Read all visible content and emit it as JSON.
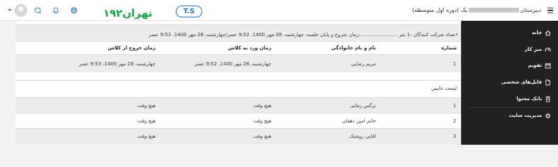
{
  "header": {
    "course_title_start": "دبیرستان",
    "course_title_end": "یک (دوره اول متوسطه)",
    "logo_text": "تهران۱۹۲",
    "logo_badge": "T.S"
  },
  "sidebar": {
    "items": [
      {
        "label": "خانه",
        "icon": "home-icon"
      },
      {
        "label": "میز کار",
        "icon": "dashboard-icon"
      },
      {
        "label": "تقویم",
        "icon": "calendar-icon"
      },
      {
        "label": "فایل‌های شخصی",
        "icon": "file-icon"
      },
      {
        "label": "بانک محتوا",
        "icon": "content-bank-icon"
      },
      {
        "label": "مدیریت سایت",
        "icon": "gear-icon"
      }
    ]
  },
  "session": {
    "info": "•تعداد شرکت کنندگان :1 نفر .........................زمان شروع و پایان جلسه: چهارشنبه، 28 مهر 1400، 9:52 عصر/چهارشنبه، 28 مهر 1400، 9:53 عصر"
  },
  "attendees": {
    "headers": [
      "شماره",
      "نام و نام خانوادگی",
      "زمان ورد به کلاس",
      "زمان خروج از کلاس"
    ],
    "rows": [
      [
        "1",
        "مریم رضایی",
        "چهارشنبه، 28 مهر 1400، 9:52 عصر",
        "چهارشنبه، 28 مهر 1400، 9:53 عصر"
      ]
    ]
  },
  "absentees": {
    "title": "لیست غایبین",
    "rows": [
      [
        "1",
        "نرگس زمانی",
        "هیچ وقت",
        "هیچ وقت"
      ],
      [
        "2",
        "خانم امین دهقان",
        "هیچ وقت",
        "هیچ وقت"
      ],
      [
        "3",
        "افاپی روشنک",
        "هیچ وقت",
        "هیچ وقت"
      ]
    ]
  },
  "colors": {
    "sidebar_bg": "#212121",
    "logo_green": "#17a34a",
    "logo_blue": "#1d70b8"
  }
}
